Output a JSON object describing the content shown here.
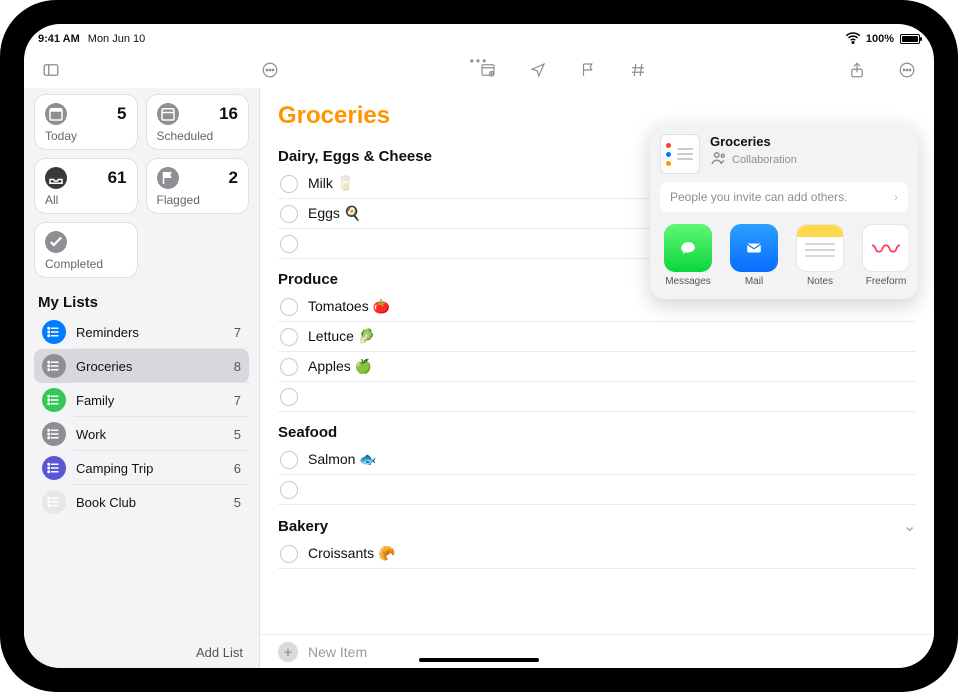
{
  "status": {
    "time": "9:41 AM",
    "date": "Mon Jun 10",
    "battery": "100%"
  },
  "toolbar": {
    "center_dots": "•••"
  },
  "sidebar": {
    "smart": {
      "today": {
        "label": "Today",
        "count": 5
      },
      "scheduled": {
        "label": "Scheduled",
        "count": 16
      },
      "all": {
        "label": "All",
        "count": 61
      },
      "flagged": {
        "label": "Flagged",
        "count": 2
      },
      "completed": {
        "label": "Completed"
      }
    },
    "header": "My Lists",
    "lists": [
      {
        "name": "Reminders",
        "count": 7,
        "color": "#007aff"
      },
      {
        "name": "Groceries",
        "count": 8,
        "color": "#8e8e93",
        "selected": true
      },
      {
        "name": "Family",
        "count": 7,
        "color": "#34c759"
      },
      {
        "name": "Work",
        "count": 5,
        "color": "#8e8e93"
      },
      {
        "name": "Camping Trip",
        "count": 6,
        "color": "#5856d6"
      },
      {
        "name": "Book Club",
        "count": 5,
        "color": "#e7e7ea",
        "muted": true
      }
    ],
    "add_list": "Add List"
  },
  "main": {
    "title": "Groceries",
    "sections": [
      {
        "header": "Dairy, Eggs & Cheese",
        "items": [
          {
            "title": "Milk 🥛"
          },
          {
            "title": "Eggs 🍳"
          },
          {
            "title": "",
            "empty": true
          }
        ]
      },
      {
        "header": "Produce",
        "items": [
          {
            "title": "Tomatoes 🍅"
          },
          {
            "title": "Lettuce 🥬"
          },
          {
            "title": "Apples 🍏"
          },
          {
            "title": "",
            "empty": true
          }
        ]
      },
      {
        "header": "Seafood",
        "items": [
          {
            "title": "Salmon 🐟"
          },
          {
            "title": "",
            "empty": true
          }
        ]
      },
      {
        "header": "Bakery",
        "collapsible": true,
        "items": [
          {
            "title": "Croissants 🥐"
          }
        ]
      }
    ],
    "new_item": "New Item"
  },
  "share": {
    "title": "Groceries",
    "subtitle": "Collaboration",
    "permissions": "People you invite can add others.",
    "apps": [
      {
        "name": "Messages",
        "kind": "messages"
      },
      {
        "name": "Mail",
        "kind": "mail"
      },
      {
        "name": "Notes",
        "kind": "notes"
      },
      {
        "name": "Freeform",
        "kind": "freeform"
      }
    ]
  }
}
